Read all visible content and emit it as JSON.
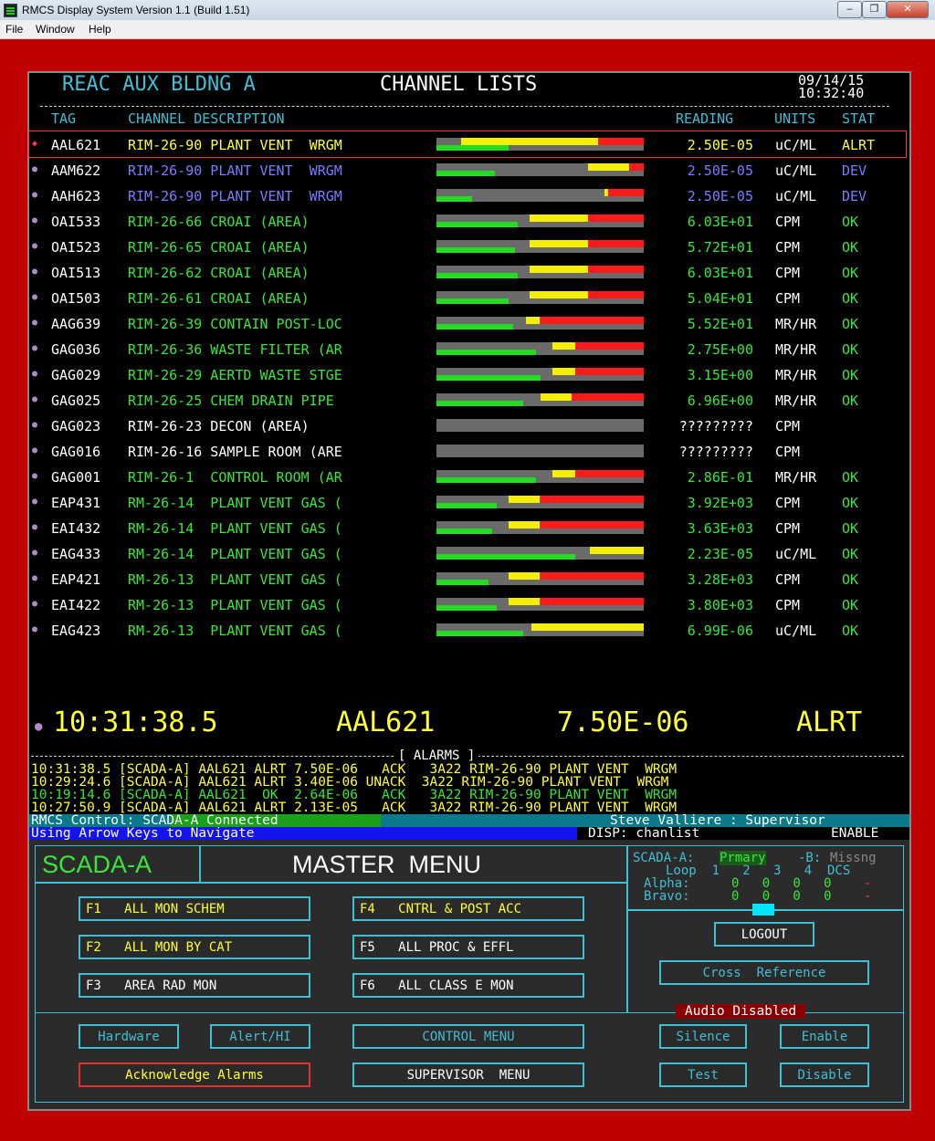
{
  "window": {
    "title": "RMCS Display System   Version 1.1   (Build 1.51)",
    "min": "‒",
    "restore": "❐",
    "close": "✕"
  },
  "menu": [
    "File",
    "Window",
    "Help"
  ],
  "header": {
    "location": "REAC AUX BLDNG A",
    "title": "CHANNEL LISTS",
    "date": "09/14/15",
    "time": "10:32:40"
  },
  "columns": {
    "tag": "TAG",
    "desc": "CHANNEL DESCRIPTION",
    "reading": "READING",
    "units": "UNITS",
    "stat": "STAT"
  },
  "rows": [
    {
      "tag": "AAL621",
      "desc": "RIM-26-90 PLANT VENT  WRGM",
      "reading": "2.50E-05",
      "units": "uC/ML",
      "stat": "ALRT",
      "color": "y",
      "bar": {
        "g": 0.35,
        "y0": 0.12,
        "y1": 0.78,
        "r1": 1.0
      }
    },
    {
      "tag": "AAM622",
      "desc": "RIM-26-90 PLANT VENT  WRGM",
      "reading": "2.50E-05",
      "units": "uC/ML",
      "stat": "DEV",
      "color": "b",
      "bar": {
        "g": 0.28,
        "y0": 0.73,
        "y1": 0.93,
        "r1": 1.0
      }
    },
    {
      "tag": "AAH623",
      "desc": "RIM-26-90 PLANT VENT  WRGM",
      "reading": "2.50E-05",
      "units": "uC/ML",
      "stat": "DEV",
      "color": "b",
      "bar": {
        "g": 0.17,
        "y0": 0.81,
        "y1": 0.83,
        "r1": 1.0
      }
    },
    {
      "tag": "OAI533",
      "desc": "RIM-26-66 CROAI (AREA)",
      "reading": "6.03E+01",
      "units": "CPM",
      "stat": "OK",
      "color": "g",
      "bar": {
        "g": 0.39,
        "y0": 0.45,
        "y1": 0.73,
        "r1": 1.0
      }
    },
    {
      "tag": "OAI523",
      "desc": "RIM-26-65 CROAI (AREA)",
      "reading": "5.72E+01",
      "units": "CPM",
      "stat": "OK",
      "color": "g",
      "bar": {
        "g": 0.38,
        "y0": 0.45,
        "y1": 0.73,
        "r1": 1.0
      }
    },
    {
      "tag": "OAI513",
      "desc": "RIM-26-62 CROAI (AREA)",
      "reading": "6.03E+01",
      "units": "CPM",
      "stat": "OK",
      "color": "g",
      "bar": {
        "g": 0.39,
        "y0": 0.45,
        "y1": 0.73,
        "r1": 1.0
      }
    },
    {
      "tag": "OAI503",
      "desc": "RIM-26-61 CROAI (AREA)",
      "reading": "5.04E+01",
      "units": "CPM",
      "stat": "OK",
      "color": "g",
      "bar": {
        "g": 0.35,
        "y0": 0.45,
        "y1": 0.73,
        "r1": 1.0
      }
    },
    {
      "tag": "AAG639",
      "desc": "RIM-26-39 CONTAIN POST-LOC",
      "reading": "5.52E+01",
      "units": "MR/HR",
      "stat": "OK",
      "color": "g",
      "bar": {
        "g": 0.37,
        "y0": 0.43,
        "y1": 0.5,
        "r1": 1.0
      }
    },
    {
      "tag": "GAG036",
      "desc": "RIM-26-36 WASTE FILTER (AR",
      "reading": "2.75E+00",
      "units": "MR/HR",
      "stat": "OK",
      "color": "g",
      "bar": {
        "g": 0.48,
        "y0": 0.56,
        "y1": 0.67,
        "r1": 1.0
      }
    },
    {
      "tag": "GAG029",
      "desc": "RIM-26-29 AERTD WASTE STGE",
      "reading": "3.15E+00",
      "units": "MR/HR",
      "stat": "OK",
      "color": "g",
      "bar": {
        "g": 0.5,
        "y0": 0.56,
        "y1": 0.67,
        "r1": 1.0
      }
    },
    {
      "tag": "GAG025",
      "desc": "RIM-26-25 CHEM DRAIN PIPE",
      "reading": "6.96E+00",
      "units": "MR/HR",
      "stat": "OK",
      "color": "g",
      "bar": {
        "g": 0.42,
        "y0": 0.5,
        "y1": 0.65,
        "r1": 1.0
      }
    },
    {
      "tag": "GAG023",
      "desc": "RIM-26-23 DECON (AREA)",
      "reading": "?????????",
      "units": "CPM",
      "stat": "",
      "color": "w",
      "bar": {
        "g": 0,
        "y0": 0,
        "y1": 0,
        "r1": 0
      }
    },
    {
      "tag": "GAG016",
      "desc": "RIM-26-16 SAMPLE ROOM (ARE",
      "reading": "?????????",
      "units": "CPM",
      "stat": "",
      "color": "w",
      "bar": {
        "g": 0,
        "y0": 0,
        "y1": 0,
        "r1": 0
      }
    },
    {
      "tag": "GAG001",
      "desc": "RIM-26-1  CONTROL ROOM (AR",
      "reading": "2.86E-01",
      "units": "MR/HR",
      "stat": "OK",
      "color": "g",
      "bar": {
        "g": 0.48,
        "y0": 0.56,
        "y1": 0.67,
        "r1": 1.0
      }
    },
    {
      "tag": "EAP431",
      "desc": "RM-26-14  PLANT VENT GAS (",
      "reading": "3.92E+03",
      "units": "CPM",
      "stat": "OK",
      "color": "g",
      "bar": {
        "g": 0.29,
        "y0": 0.35,
        "y1": 0.5,
        "r1": 1.0
      }
    },
    {
      "tag": "EAI432",
      "desc": "RM-26-14  PLANT VENT GAS (",
      "reading": "3.63E+03",
      "units": "CPM",
      "stat": "OK",
      "color": "g",
      "bar": {
        "g": 0.27,
        "y0": 0.35,
        "y1": 0.5,
        "r1": 1.0
      }
    },
    {
      "tag": "EAG433",
      "desc": "RM-26-14  PLANT VENT GAS (",
      "reading": "2.23E-05",
      "units": "uC/ML",
      "stat": "OK",
      "color": "g",
      "bar": {
        "g": 0.67,
        "y0": 0.74,
        "y1": 1.0,
        "r1": 1.0
      }
    },
    {
      "tag": "EAP421",
      "desc": "RM-26-13  PLANT VENT GAS (",
      "reading": "3.28E+03",
      "units": "CPM",
      "stat": "OK",
      "color": "g",
      "bar": {
        "g": 0.25,
        "y0": 0.35,
        "y1": 0.5,
        "r1": 1.0
      }
    },
    {
      "tag": "EAI422",
      "desc": "RM-26-13  PLANT VENT GAS (",
      "reading": "3.80E+03",
      "units": "CPM",
      "stat": "OK",
      "color": "g",
      "bar": {
        "g": 0.29,
        "y0": 0.35,
        "y1": 0.5,
        "r1": 1.0
      }
    },
    {
      "tag": "EAG423",
      "desc": "RM-26-13  PLANT VENT GAS (",
      "reading": "6.99E-06",
      "units": "uC/ML",
      "stat": "OK",
      "color": "g",
      "bar": {
        "g": 0.42,
        "y0": 0.46,
        "y1": 1.0,
        "r1": 1.0
      }
    }
  ],
  "latest": {
    "time": "10:31:38.5",
    "tag": "AAL621",
    "value": "7.50E-06",
    "stat": "ALRT"
  },
  "alarms_title": "[ ALARMS ]",
  "alarms": [
    "10:31:38.5 [SCADA-A] AAL621 ALRT 7.50E-06   ACK   3A22 RIM-26-90 PLANT VENT  WRGM",
    "10:29:24.6 [SCADA-A] AAL621 ALRT 3.40E-06 UNACK  3A22 RIM-26-90 PLANT VENT  WRGM",
    "10:19:14.6 [SCADA-A] AAL621  OK  2.64E-06   ACK   3A22 RIM-26-90 PLANT VENT  WRGM",
    "10:27:50.9 [SCADA-A] AAL621 ALRT 2.13E-05   ACK   3A22 RIM-26-90 PLANT VENT  WRGM"
  ],
  "status": {
    "control": "RMCS Control: SCADA-A Connected",
    "user": "Steve Valliere : Supervisor",
    "hint": "Using Arrow Keys to Navigate",
    "disp": "DISP: chanlist",
    "enable": "ENABLE"
  },
  "menu_panel": {
    "scada": "SCADA-A",
    "title": "MASTER  MENU",
    "side": {
      "a": "SCADA-A:",
      "prim": "Prmary",
      "b": "-B:",
      "miss": "Missng",
      "loop": "Loop  1   2   3   4  DCS",
      "alpha": "Alpha:",
      "bravo": "Bravo:",
      "vals": "0   0   0   0",
      "dash": "-"
    },
    "f1": "F1   ALL MON SCHEM",
    "f2": "F2   ALL MON BY CAT",
    "f3": "F3   AREA RAD MON",
    "f4": "F4   CNTRL & POST ACC",
    "f5": "F5   ALL PROC & EFFL",
    "f6": "F6   ALL CLASS E MON",
    "logout": "LOGOUT",
    "crossref": "Cross  Reference",
    "hardware": "Hardware",
    "alerthi": "Alert/HI",
    "control": "CONTROL MENU",
    "supervisor": "SUPERVISOR  MENU",
    "ack": "Acknowledge Alarms",
    "audio": "Audio Disabled",
    "silence": "Silence",
    "enable": "Enable",
    "test": "Test",
    "disable": "Disable"
  }
}
